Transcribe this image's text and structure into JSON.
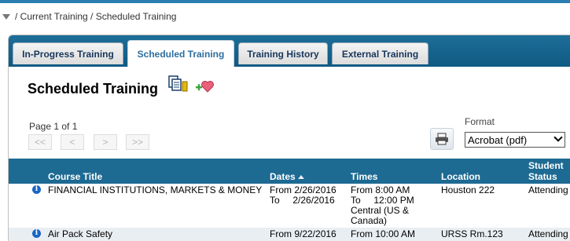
{
  "breadcrumb": {
    "text": "/ Current Training / Scheduled Training"
  },
  "tabs": [
    {
      "label": "In-Progress Training"
    },
    {
      "label": "Scheduled Training"
    },
    {
      "label": "Training History"
    },
    {
      "label": "External Training"
    }
  ],
  "page": {
    "title": "Scheduled Training"
  },
  "pagination": {
    "info": "Page 1 of 1",
    "first": "<<",
    "prev": "<",
    "next": ">",
    "last": ">>"
  },
  "format": {
    "label": "Format",
    "selected": "Acrobat (pdf)"
  },
  "table": {
    "columns": {
      "course": "Course Title",
      "dates": "Dates",
      "times": "Times",
      "location": "Location",
      "status_line1": "Student",
      "status_line2": "Status"
    },
    "rows": [
      {
        "course": "FINANCIAL INSTITUTIONS, MARKETS & MONEY",
        "dates_line1": "From 2/26/2016",
        "dates_line2": "To     2/26/2016",
        "times_line1": "From 8:00 AM",
        "times_line2": "To     12:00 PM",
        "times_line3": "Central (US &",
        "times_line4": "Canada)",
        "location": "Houston 222",
        "status": "Attending"
      },
      {
        "course": "Air Pack Safety",
        "dates_line1": "From 9/22/2016",
        "times_line1": "From 10:00 AM",
        "location": "URSS Rm.123",
        "status": "Attending"
      }
    ]
  },
  "colors": {
    "header_blue": "#1d6a93",
    "tab_bar": "#0f5a83",
    "accent": "#2a7fb0"
  },
  "icons": [
    "collapse-triangle-icon",
    "copy-documents-icon",
    "add-favorite-icon",
    "printer-icon",
    "sort-ascending-icon",
    "info-icon"
  ]
}
